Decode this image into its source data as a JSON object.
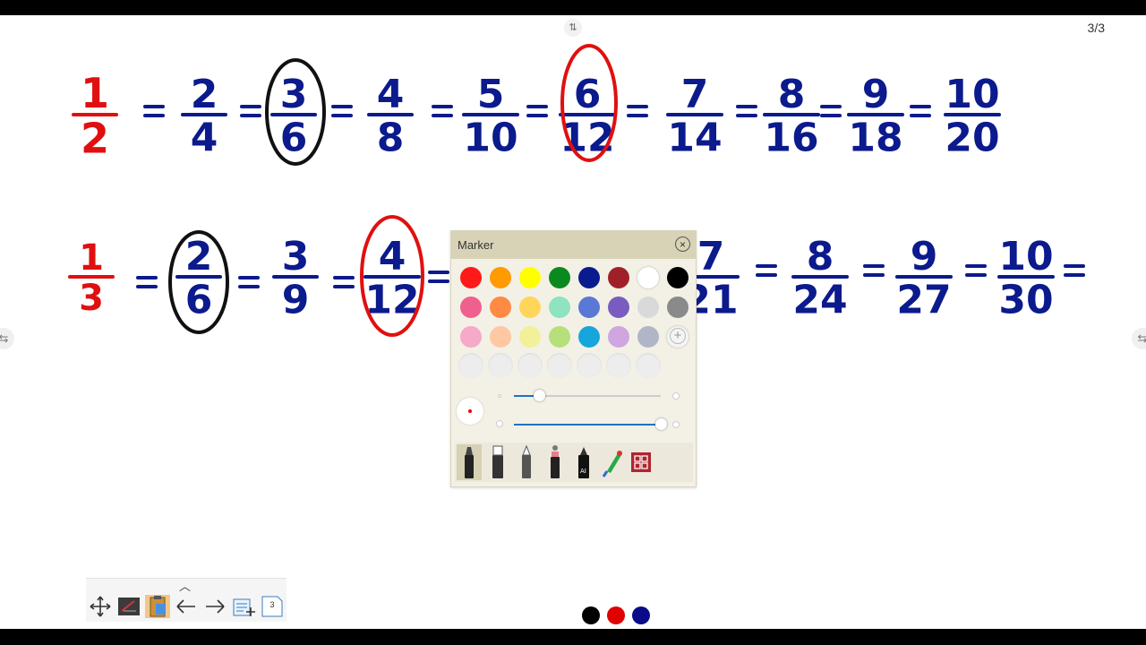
{
  "page_counter": "3/3",
  "top_handle_icon": "swap-vertical-icon",
  "side_handle_icon": "swap-horizontal-icon",
  "equation_rows": [
    {
      "lead": {
        "n": "1",
        "d": "2"
      },
      "terms": [
        {
          "n": "2",
          "d": "4"
        },
        {
          "n": "3",
          "d": "6"
        },
        {
          "n": "4",
          "d": "8"
        },
        {
          "n": "5",
          "d": "10"
        },
        {
          "n": "6",
          "d": "12"
        },
        {
          "n": "7",
          "d": "14"
        },
        {
          "n": "8",
          "d": "16"
        },
        {
          "n": "9",
          "d": "18"
        },
        {
          "n": "10",
          "d": "20"
        }
      ]
    },
    {
      "lead": {
        "n": "1",
        "d": "3"
      },
      "terms": [
        {
          "n": "2",
          "d": "6"
        },
        {
          "n": "3",
          "d": "9"
        },
        {
          "n": "4",
          "d": "12"
        },
        {
          "n": "7",
          "d": "21"
        },
        {
          "n": "8",
          "d": "24"
        },
        {
          "n": "9",
          "d": "27"
        },
        {
          "n": "10",
          "d": "30"
        }
      ]
    }
  ],
  "ink_colors": {
    "red": "#e01010",
    "blue": "#0b1a8c",
    "black": "#111111"
  },
  "marker_panel": {
    "title": "Marker",
    "close_icon": "close-circle-icon",
    "swatch_rows": [
      [
        "#ff1a1a",
        "#ff9a00",
        "#ffff00",
        "#0a8a1e",
        "#0a1a8f",
        "#a0202a",
        "#ffffff",
        "#000000"
      ],
      [
        "#f0608e",
        "#ff8a44",
        "#ffd65a",
        "#8ee3c0",
        "#5a78d6",
        "#7a5cc0",
        "#d9d9d9",
        "#8a8a8a"
      ],
      [
        "#f6a9c8",
        "#ffc8a3",
        "#f3f09a",
        "#b6e07a",
        "#17a6dc",
        "#cfa6e0",
        "#b0b6c8",
        "#f4f4f4"
      ]
    ],
    "empty_swatch_count": 7,
    "thickness_value": 0.17,
    "opacity_value": 1.0,
    "tools": [
      "marker-pen-icon",
      "highlighter-icon",
      "felt-pen-icon",
      "special-pen-icon",
      "ai-pen-icon",
      "parrot-brush-icon",
      "pattern-brush-icon"
    ]
  },
  "bottom_toolbar": {
    "collapse_icon": "chevron-up-icon",
    "page_number": "3",
    "tools": [
      "move-icon",
      "whiteboard-icon",
      "clipboard-icon",
      "arrow-left-icon",
      "arrow-right-icon",
      "add-page-icon",
      "page-list-icon"
    ]
  },
  "pen_colors": [
    "#000000",
    "#e00000",
    "#0a0a8a"
  ]
}
